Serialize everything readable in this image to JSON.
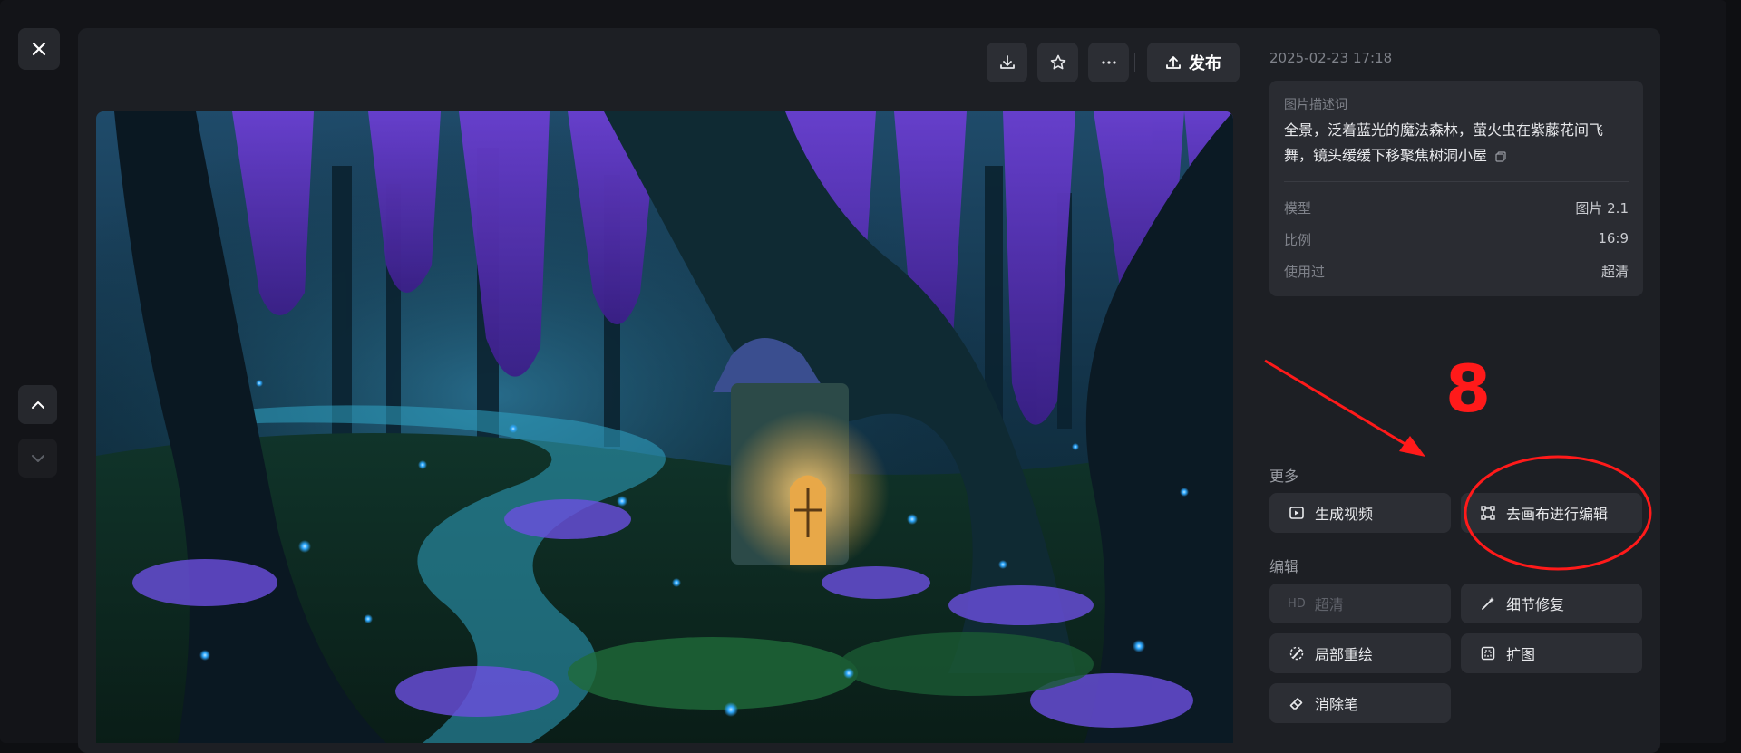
{
  "toolbar": {
    "publish_label": "发布",
    "icons": [
      "download-icon",
      "star-icon",
      "more-icon",
      "upload-icon"
    ]
  },
  "meta": {
    "date": "2025-02-23 17:18"
  },
  "info": {
    "prompt_label": "图片描述词",
    "prompt_text": "全景，泛着蓝光的魔法森林，萤火虫在紫藤花间飞舞，镜头缓缓下移聚焦树洞小屋",
    "rows": [
      {
        "key": "模型",
        "value": "图片 2.1"
      },
      {
        "key": "比例",
        "value": "16:9"
      },
      {
        "key": "使用过",
        "value": "超清"
      }
    ]
  },
  "more": {
    "title": "更多",
    "generate_video": "生成视频",
    "edit_canvas": "去画布进行编辑"
  },
  "edit": {
    "title": "编辑",
    "hd_badge": "HD",
    "hd_label": "超清",
    "detail_fix": "细节修复",
    "partial_redraw": "局部重绘",
    "expand": "扩图",
    "eraser": "消除笔"
  },
  "annotation": {
    "number": "8",
    "color": "#ff1a1a"
  },
  "colors": {
    "panel": "#1d1f24",
    "card": "#2a2c32",
    "button": "#2c2e34"
  }
}
